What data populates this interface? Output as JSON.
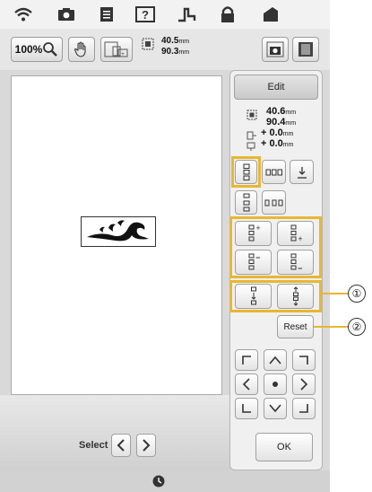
{
  "toolbar": {
    "zoom_label": "100%"
  },
  "size": {
    "width": "40.5",
    "height": "90.3",
    "unit": "mm"
  },
  "panel": {
    "edit_label": "Edit",
    "width": "40.6",
    "height": "90.4",
    "offset_x": "+ 0.0",
    "offset_y": "+ 0.0",
    "unit": "mm",
    "reset_label": "Reset",
    "ok_label": "OK"
  },
  "bottom": {
    "select_label": "Select"
  },
  "callouts": {
    "one": "①",
    "two": "②"
  },
  "colors": {
    "highlight": "#e8b731",
    "panel": "#f0f0f0"
  }
}
